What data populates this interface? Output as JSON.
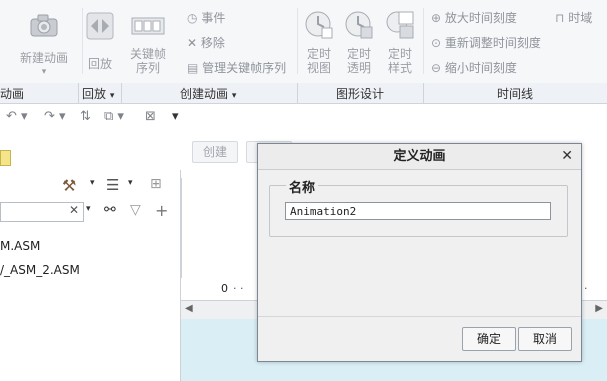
{
  "ribbon": {
    "new_animation": "新建动画",
    "playback": "回放",
    "keyframe_seq_line1": "关键帧",
    "keyframe_seq_line2": "序列",
    "event": "事件",
    "remove": "移除",
    "manage_keyframe_seq": "管理关键帧序列",
    "timed_view_1": "定时",
    "timed_view_2": "视图",
    "timed_transparency_1": "定时",
    "timed_transparency_2": "透明",
    "timed_style_1": "定时",
    "timed_style_2": "样式",
    "zoom_in_ticks": "放大时间刻度",
    "readjust_ticks": "重新调整时间刻度",
    "zoom_out_ticks": "缩小时间刻度",
    "time_domain": "时域"
  },
  "groups": {
    "animation": "动画",
    "playback": "回放",
    "create_animation": "创建动画",
    "graphic_design": "图形设计",
    "timeline": "时间线"
  },
  "toolbar": {
    "create": "创建"
  },
  "tree": {
    "item1": "M.ASM",
    "item2": "/_ASM_2.ASM"
  },
  "timeline": {
    "tick0": "0"
  },
  "dialog": {
    "title": "定义动画",
    "group_label": "名称",
    "name_value": "Animation2",
    "ok": "确定",
    "cancel": "取消"
  }
}
